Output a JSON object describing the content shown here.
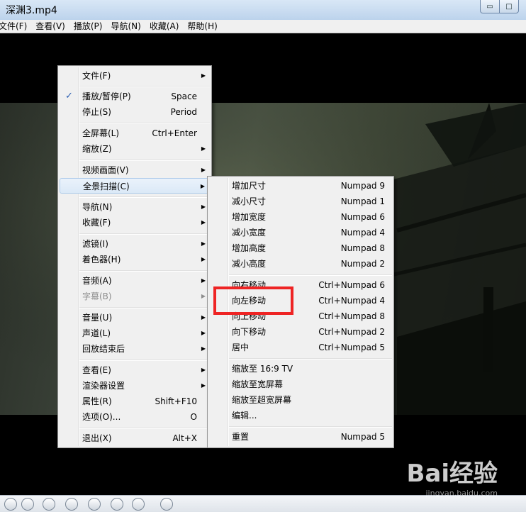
{
  "window": {
    "title": "深渊3.mp4",
    "minimize": "▭",
    "maximize": "□"
  },
  "menubar": [
    "文件(F)",
    "查看(V)",
    "播放(P)",
    "导航(N)",
    "收藏(A)",
    "帮助(H)"
  ],
  "context_menu": {
    "items": [
      {
        "label": "文件(F)",
        "submenu": true
      },
      {
        "label": "播放/暂停(P)",
        "shortcut": "Space",
        "checked": true
      },
      {
        "label": "停止(S)",
        "shortcut": "Period"
      },
      {
        "label": "全屏幕(L)",
        "shortcut": "Ctrl+Enter"
      },
      {
        "label": "缩放(Z)",
        "submenu": true
      },
      {
        "label": "视频画面(V)",
        "submenu": true
      },
      {
        "label": "全景扫描(C)",
        "submenu": true,
        "highlighted": true
      },
      {
        "label": "导航(N)",
        "submenu": true
      },
      {
        "label": "收藏(F)",
        "submenu": true
      },
      {
        "label": "滤镜(I)",
        "submenu": true
      },
      {
        "label": "着色器(H)",
        "submenu": true
      },
      {
        "label": "音频(A)",
        "submenu": true
      },
      {
        "label": "字幕(B)",
        "submenu": true,
        "disabled": true
      },
      {
        "label": "音量(U)",
        "submenu": true
      },
      {
        "label": "声道(L)",
        "submenu": true
      },
      {
        "label": "回放结束后",
        "submenu": true
      },
      {
        "label": "查看(E)",
        "submenu": true
      },
      {
        "label": "渲染器设置",
        "submenu": true
      },
      {
        "label": "属性(R)",
        "shortcut": "Shift+F10"
      },
      {
        "label": "选项(O)...",
        "shortcut": "O"
      },
      {
        "label": "退出(X)",
        "shortcut": "Alt+X"
      }
    ]
  },
  "pan_scan_submenu": {
    "items": [
      {
        "label": "增加尺寸",
        "shortcut": "Numpad 9"
      },
      {
        "label": "减小尺寸",
        "shortcut": "Numpad 1"
      },
      {
        "label": "增加宽度",
        "shortcut": "Numpad 6"
      },
      {
        "label": "减小宽度",
        "shortcut": "Numpad 4"
      },
      {
        "label": "增加高度",
        "shortcut": "Numpad 8"
      },
      {
        "label": "减小高度",
        "shortcut": "Numpad 2"
      },
      {
        "label": "向右移动",
        "shortcut": "Ctrl+Numpad 6"
      },
      {
        "label": "向左移动",
        "shortcut": "Ctrl+Numpad 4"
      },
      {
        "label": "向上移动",
        "shortcut": "Ctrl+Numpad 8"
      },
      {
        "label": "向下移动",
        "shortcut": "Ctrl+Numpad 2"
      },
      {
        "label": "居中",
        "shortcut": "Ctrl+Numpad 5"
      },
      {
        "label": "缩放至 16:9 TV"
      },
      {
        "label": "缩放至宽屏幕"
      },
      {
        "label": "缩放至超宽屏幕"
      },
      {
        "label": "编辑..."
      },
      {
        "label": "重置",
        "shortcut": "Numpad 5"
      }
    ]
  },
  "watermark": {
    "brand": "Bai经验",
    "url": "jingyan.baidu.com"
  },
  "icons": {
    "check": "✓",
    "submenu_arrow": "▶"
  }
}
